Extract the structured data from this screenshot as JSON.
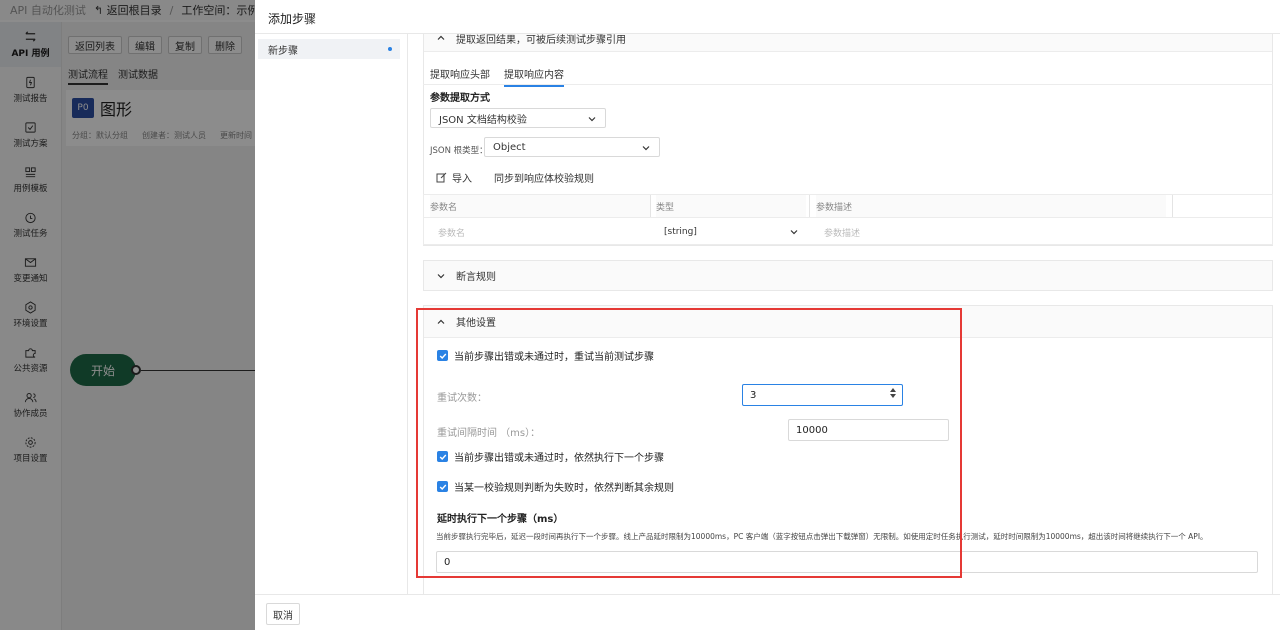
{
  "background": {
    "app_title": "API 自动化测试",
    "back_link": "返回根目录",
    "workspace_label": "工作空间：示例",
    "sidebar": [
      {
        "label": "API 用例",
        "icon": "api-icon",
        "active": true
      },
      {
        "label": "测试报告",
        "icon": "report-icon"
      },
      {
        "label": "测试方案",
        "icon": "plan-icon"
      },
      {
        "label": "用例模板",
        "icon": "template-icon"
      },
      {
        "label": "测试任务",
        "icon": "clock-icon"
      },
      {
        "label": "变更通知",
        "icon": "mail-icon"
      },
      {
        "label": "环境设置",
        "icon": "env-icon"
      },
      {
        "label": "公共资源",
        "icon": "puzzle-icon"
      },
      {
        "label": "协作成员",
        "icon": "members-icon"
      },
      {
        "label": "项目设置",
        "icon": "gear-icon"
      }
    ],
    "toolbar": [
      "返回列表",
      "编辑",
      "复制",
      "删除"
    ],
    "tabs": [
      "测试流程",
      "测试数据"
    ],
    "case": {
      "priority": "P0",
      "title": "图形",
      "group": "分组：默认分组",
      "creator": "创建者：测试人员",
      "updated": "更新时间"
    },
    "start_node": "开始"
  },
  "drawer": {
    "title": "添加步骤",
    "step_item": "新步骤",
    "extract_section": {
      "title": "提取返回结果，可被后续测试步骤引用",
      "tabs": [
        "提取响应头部",
        "提取响应内容"
      ],
      "active_tab": 1,
      "method_label": "参数提取方式",
      "method_value": "JSON 文档结构校验",
      "root_type_label": "JSON 根类型：",
      "root_type_value": "Object",
      "import_label": "导入",
      "sync_label": "同步到响应体校验规则",
      "table": {
        "headers": [
          "参数名",
          "类型",
          "参数描述"
        ],
        "row": {
          "name_placeholder": "参数名",
          "type": "[string]",
          "desc_placeholder": "参数描述"
        }
      }
    },
    "assert_section": {
      "title": "断言规则"
    },
    "other_section": {
      "title": "其他设置",
      "retry_checkbox": "当前步骤出错或未通过时，重试当前测试步骤",
      "retry_count_label": "重试次数：",
      "retry_count_value": "3",
      "retry_interval_label": "重试间隔时间 （ms）：",
      "retry_interval_value": "10000",
      "continue_checkbox": "当前步骤出错或未通过时，依然执行下一个步骤",
      "continue_rules_checkbox": "当某一校验规则判断为失败时，依然判断其余规则",
      "delay_title": "延时执行下一个步骤（ms）",
      "delay_desc": "当前步骤执行完毕后，延迟一段时间再执行下一个步骤。线上产品延时限制为10000ms，PC 客户端（蓝字按钮点击弹出下载弹窗）无限制。如使用定时任务执行测试，延时时间限制为10000ms，超出该时间将继续执行下一个 API。",
      "delay_value": "0"
    },
    "cancel_label": "取消"
  },
  "colors": {
    "accent": "#2a82e4",
    "highlight": "#e53935",
    "start_node": "#1e6b47"
  }
}
